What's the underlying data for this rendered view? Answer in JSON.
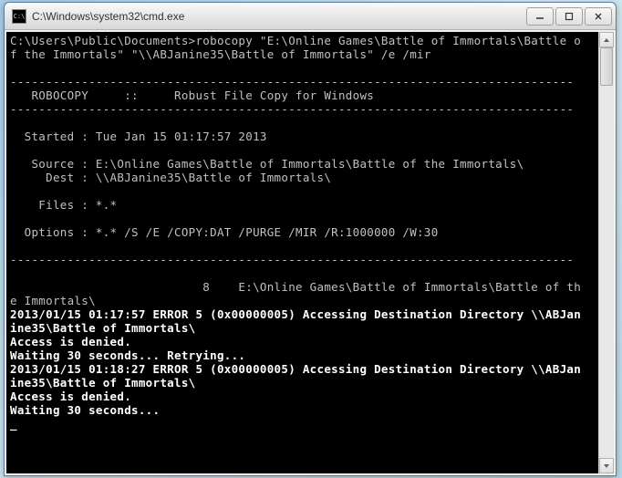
{
  "window": {
    "title": "C:\\Windows\\system32\\cmd.exe",
    "icon_label": "C:\\"
  },
  "terminal": {
    "prompt_line1": "C:\\Users\\Public\\Documents>robocopy \"E:\\Online Games\\Battle of Immortals\\Battle o",
    "prompt_line2": "f the Immortals\" \"\\\\ABJanine35\\Battle of Immortals\" /e /mir",
    "hr": "-------------------------------------------------------------------------------",
    "header": "   ROBOCOPY     ::     Robust File Copy for Windows",
    "started": "  Started : Tue Jan 15 01:17:57 2013",
    "source": "   Source : E:\\Online Games\\Battle of Immortals\\Battle of the Immortals\\",
    "dest": "     Dest : \\\\ABJanine35\\Battle of Immortals\\",
    "files": "    Files : *.*",
    "options": "  Options : *.* /S /E /COPY:DAT /PURGE /MIR /R:1000000 /W:30",
    "dircount_line1": "                           8    E:\\Online Games\\Battle of Immortals\\Battle of th",
    "dircount_line2": "e Immortals\\",
    "err1_line1": "2013/01/15 01:17:57 ERROR 5 (0x00000005) Accessing Destination Directory \\\\ABJan",
    "err1_line2": "ine35\\Battle of Immortals\\",
    "access_denied": "Access is denied.",
    "waiting_retry": "Waiting 30 seconds... Retrying...",
    "err2_line1": "2013/01/15 01:18:27 ERROR 5 (0x00000005) Accessing Destination Directory \\\\ABJan",
    "err2_line2": "ine35\\Battle of Immortals\\",
    "waiting": "Waiting 30 seconds...",
    "cursor": "_"
  }
}
